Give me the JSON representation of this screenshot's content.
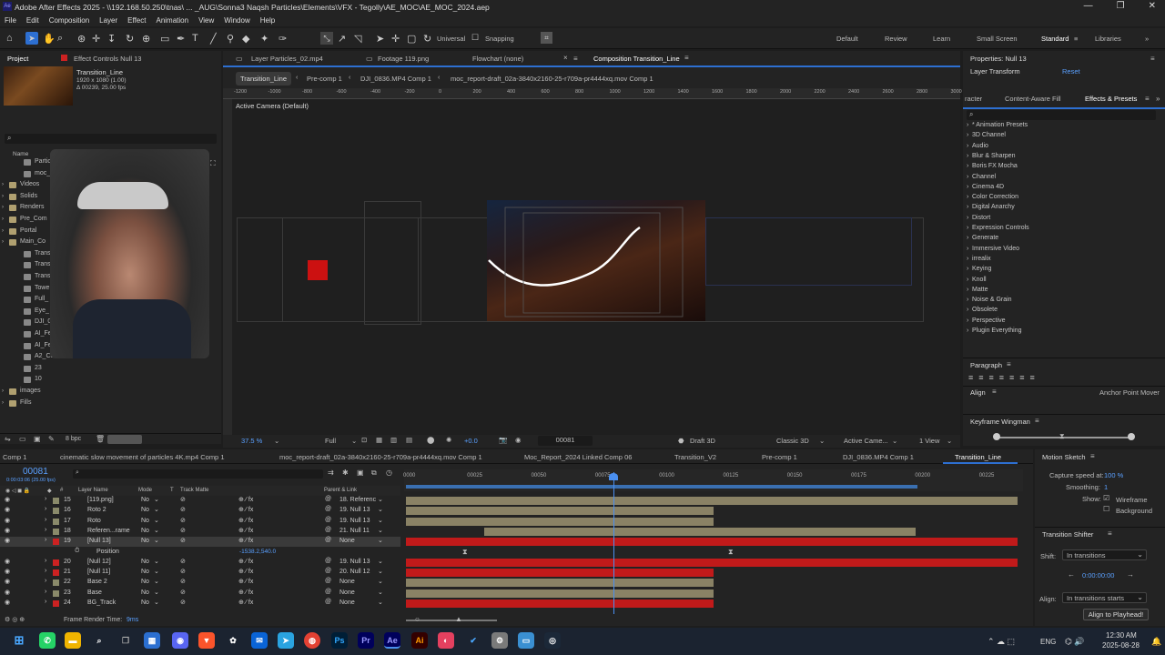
{
  "app": {
    "title": "Adobe After Effects 2025 - \\\\192.168.50.250\\tnas\\ ... _AUG\\Sonna3 Naqsh Particles\\Elements\\VFX - Tegolly\\AE_MOC\\AE_MOC_2024.aep",
    "window_buttons": [
      "—",
      "❐",
      "✕"
    ]
  },
  "menu": [
    "File",
    "Edit",
    "Composition",
    "Layer",
    "Effect",
    "Animation",
    "View",
    "Window",
    "Help"
  ],
  "toolbar": {
    "universal_label": "Universal",
    "snapping_label": "Snapping",
    "workspaces": [
      "Default",
      "Review",
      "Learn",
      "Small Screen",
      "Standard",
      "Libraries"
    ],
    "active_workspace": "Standard"
  },
  "project_panel": {
    "tab_project": "Project",
    "tab_effect_controls": "Effect Controls Null 13",
    "comp_name": "Transition_Line",
    "comp_res": "1920 x 1080 (1.00)",
    "comp_dur": "Δ 00239, 25.00 fps",
    "search_placeholder": "",
    "col_name": "Name",
    "items": [
      "Particles_",
      "moc_rep",
      "Videos",
      "Solids",
      "Renders",
      "Pre_Com",
      "Portal",
      "Main_Co",
      "Trans",
      "Trans",
      "Trans",
      "Towe",
      "Full_",
      "Eye_",
      "DJI_0",
      "AI_Fe",
      "AI_Feel",
      "A2_C35",
      "23",
      "10",
      "images",
      "Fills"
    ],
    "bpc": "8 bpc"
  },
  "viewer": {
    "top_tabs": [
      "Layer Particles_02.mp4",
      "Footage 119.png",
      "Flowchart (none)",
      "Composition Transition_Line"
    ],
    "breadcrumbs": [
      "Transition_Line",
      "Pre-comp 1",
      "DJI_0836.MP4 Comp 1",
      "moc_report-draft_02a-3840x2160-25-r709a-pr4444xq.mov Comp 1"
    ],
    "camera_label": "Active Camera (Default)",
    "ruler_ticks": [
      "-1200",
      "-1000",
      "-800",
      "-600",
      "-400",
      "-200",
      "0",
      "200",
      "400",
      "600",
      "800",
      "1000",
      "1200",
      "1400",
      "1600",
      "1800",
      "2000",
      "2200",
      "2400",
      "2600",
      "2800",
      "3000"
    ],
    "zoom": "37.5 %",
    "resolution": "Full",
    "exposure": "+0.0",
    "timecode": "00081",
    "renderer": "Draft 3D",
    "classic": "Classic 3D",
    "camera_dropdown": "Active Came...",
    "view_dropdown": "1 View"
  },
  "right_panel": {
    "properties_title": "Properties: Null 13",
    "layer_transform": "Layer Transform",
    "reset": "Reset",
    "tabs": [
      "racter",
      "Content-Aware Fill",
      "Effects & Presets"
    ],
    "effects": [
      "* Animation Presets",
      "3D Channel",
      "Audio",
      "Blur & Sharpen",
      "Boris FX Mocha",
      "Channel",
      "Cinema 4D",
      "Color Correction",
      "Digital Anarchy",
      "Distort",
      "Expression Controls",
      "Generate",
      "Immersive Video",
      "irrealix",
      "Keying",
      "Knoll",
      "Matte",
      "Noise & Grain",
      "Obsolete",
      "Perspective",
      "Plugin Everything"
    ],
    "paragraph_title": "Paragraph",
    "align_title": "Align",
    "anchor_point_mover": "Anchor Point Mover",
    "keyframe_wingman": "Keyframe Wingman",
    "motion_sketch": "Motion Sketch",
    "capture_speed_label": "Capture speed at:",
    "capture_speed_value": "100 %",
    "smoothing_label": "Smoothing:",
    "smoothing_value": "1",
    "show_label": "Show:",
    "wireframe_label": "Wireframe",
    "background_label": "Background",
    "transition_shifter": "Transition Shifter",
    "shift_label": "Shift:",
    "shift_value": "In transitions",
    "shift_time": "0:00:00:00",
    "align_label": "Align:",
    "align_value": "In transitions starts",
    "align_button": "Align to Playhead!"
  },
  "timeline": {
    "tabs": [
      "Comp 1",
      "cinematic slow movement of particles 4K.mp4 Comp 1",
      "moc_report-draft_02a-3840x2160-25-r709a-pr4444xq.mov Comp 1",
      "Moc_Report_2024 Linked Comp 06",
      "Transition_V2",
      "Pre-comp 1",
      "DJI_0836.MP4 Comp 1",
      "Transition_Line"
    ],
    "current_time": "00081",
    "current_time_sub": "0:00:03:06 (25.00 fps)",
    "columns": [
      "#",
      "Layer Name",
      "Mode",
      "T",
      "Track Matte",
      "Parent & Link"
    ],
    "ruler": [
      "0000",
      "00025",
      "00050",
      "00075",
      "00100",
      "00125",
      "00150",
      "00175",
      "00200",
      "00225"
    ],
    "layers": [
      {
        "num": "15",
        "name": "[119.png]",
        "mode": "No",
        "parent": "18. Referenc",
        "color": "#8a8a6a"
      },
      {
        "num": "16",
        "name": "Roto 2",
        "mode": "No",
        "parent": "19. Null 13",
        "color": "#8a8a6a"
      },
      {
        "num": "17",
        "name": "Roto",
        "mode": "No",
        "parent": "19. Null 13",
        "color": "#8a8a6a"
      },
      {
        "num": "18",
        "name": "Referen...rame",
        "mode": "No",
        "parent": "21. Null 11",
        "color": "#8a8a6a"
      },
      {
        "num": "19",
        "name": "[Null 13]",
        "mode": "No",
        "parent": "None",
        "color": "#cc2222"
      },
      {
        "num": "",
        "name": "Position",
        "mode": "",
        "parent": "",
        "color": ""
      },
      {
        "num": "20",
        "name": "[Null 12]",
        "mode": "No",
        "parent": "19. Null 13",
        "color": "#cc2222"
      },
      {
        "num": "21",
        "name": "[Null 11]",
        "mode": "No",
        "parent": "20. Null 12",
        "color": "#cc2222"
      },
      {
        "num": "22",
        "name": "Base 2",
        "mode": "No",
        "parent": "None",
        "color": "#8a8a6a"
      },
      {
        "num": "23",
        "name": "Base",
        "mode": "No",
        "parent": "None",
        "color": "#8a8a6a"
      },
      {
        "num": "24",
        "name": "BG_Track",
        "mode": "No",
        "parent": "None",
        "color": "#cc2222"
      }
    ],
    "position_value": "-1538.2,540.0",
    "frame_render": "Frame Render Time:",
    "frame_render_value": "9ms"
  },
  "taskbar": {
    "time": "12:30 AM",
    "date": "2025-08-28",
    "lang": "ENG",
    "apps": [
      "Ps",
      "Pr",
      "Ae",
      "Ai"
    ]
  }
}
